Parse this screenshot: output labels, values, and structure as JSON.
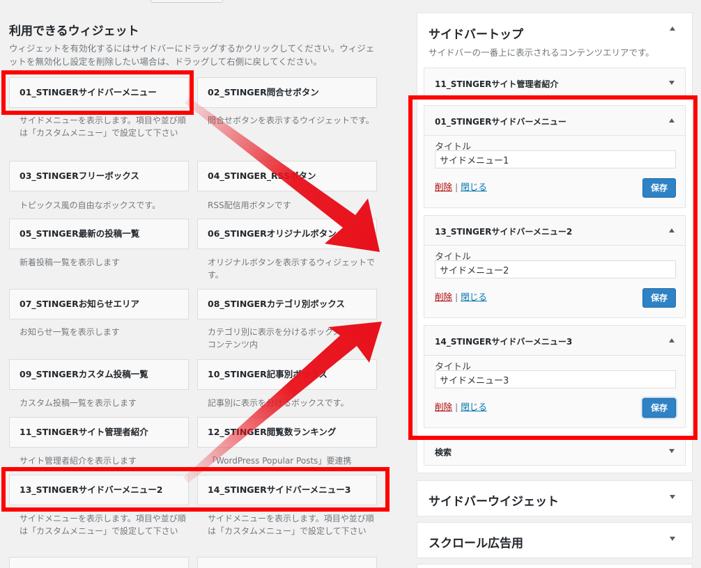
{
  "available": {
    "title": "利用できるウィジェット",
    "description": "ウィジェットを有効化するにはサイドバーにドラッグするかクリックしてください。ウィジェットを無効化し設定を削除したい場合は、ドラッグして右側に戻してください。",
    "widgets": [
      {
        "name": "01_STINGERサイドバーメニュー",
        "desc": "サイドメニューを表示します。項目や並び順は「カスタムメニュー」で設定して下さい"
      },
      {
        "name": "02_STINGER問合せボタン",
        "desc": "問合せボタンを表示するウイジェットです。"
      },
      {
        "name": "03_STINGERフリーボックス",
        "desc": "トピックス風の自由なボックスです。"
      },
      {
        "name": "04_STINGER_RSSボタン",
        "desc": "RSS配信用ボタンです"
      },
      {
        "name": "05_STINGER最新の投稿一覧",
        "desc": "新着投稿一覧を表示します"
      },
      {
        "name": "06_STINGERオリジナルボタン",
        "desc": "オリジナルボタンを表示するウィジェットです。"
      },
      {
        "name": "07_STINGERお知らせエリア",
        "desc": "お知らせ一覧を表示します"
      },
      {
        "name": "08_STINGERカテゴリ別ボックス",
        "desc": "カテゴリ別に表示を分けるボックスです。※コンテンツ内"
      },
      {
        "name": "09_STINGERカスタム投稿一覧",
        "desc": "カスタム投稿一覧を表示します"
      },
      {
        "name": "10_STINGER記事別ボックス",
        "desc": "記事別に表示を分けるボックスです。"
      },
      {
        "name": "11_STINGERサイト管理者紹介",
        "desc": "サイト管理者紹介を表示します"
      },
      {
        "name": "12_STINGER閲覧数ランキング",
        "desc": "「WordPress Popular Posts」要連携"
      },
      {
        "name": "13_STINGERサイドバーメニュー2",
        "desc": "サイドメニューを表示します。項目や並び順は「カスタムメニュー」で設定して下さい"
      },
      {
        "name": "14_STINGERサイドバーメニュー3",
        "desc": "サイドメニューを表示します。項目や並び順は「カスタムメニュー」で設定して下さい"
      }
    ]
  },
  "sidebar_top": {
    "title": "サイドバートップ",
    "description": "サイドバーの一番上に表示されるコンテンツエリアです。",
    "widgets": [
      {
        "name": "11_STINGERサイト管理者紹介"
      },
      {
        "name": "01_STINGERサイドバーメニュー",
        "field_label": "タイトル",
        "value": "サイドメニュー1",
        "delete": "削除",
        "separator": "|",
        "close": "閉じる",
        "save": "保存"
      },
      {
        "name": "13_STINGERサイドバーメニュー2",
        "field_label": "タイトル",
        "value": "サイドメニュー2",
        "delete": "削除",
        "separator": "|",
        "close": "閉じる",
        "save": "保存"
      },
      {
        "name": "14_STINGERサイドバーメニュー3",
        "field_label": "タイトル",
        "value": "サイドメニュー3",
        "delete": "削除",
        "separator": "|",
        "close": "閉じる",
        "save": "保存"
      },
      {
        "name": "検索"
      }
    ]
  },
  "other_areas": [
    {
      "title": "サイドバーウイジェット"
    },
    {
      "title": "スクロール広告用"
    }
  ],
  "colors": {
    "highlight": "#ff0000",
    "arrow": "#e8101a",
    "save_button": "#2f82c4",
    "delete_link": "#aa0000",
    "close_link": "#0073aa"
  }
}
